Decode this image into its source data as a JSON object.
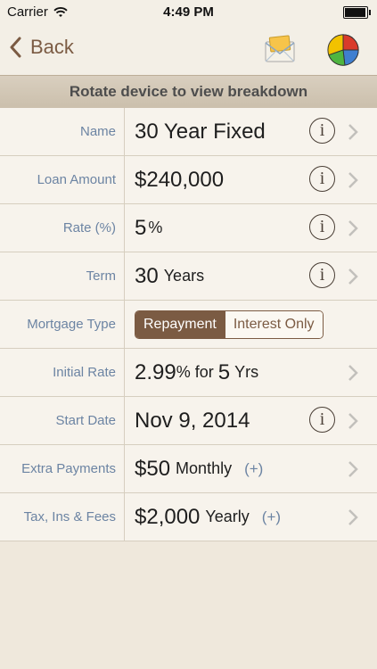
{
  "status": {
    "carrier": "Carrier",
    "time": "4:49 PM",
    "battery_level": 0.95
  },
  "nav": {
    "back_label": "Back",
    "icons": [
      "email-envelope-icon",
      "pie-chart-icon"
    ]
  },
  "banner": "Rotate device to view breakdown",
  "rows": {
    "name": {
      "label": "Name",
      "value": "30 Year Fixed"
    },
    "loan": {
      "label": "Loan Amount",
      "value": "$240,000"
    },
    "rate": {
      "label": "Rate (%)",
      "value": "5",
      "unit": "%"
    },
    "term": {
      "label": "Term",
      "value": "30",
      "unit": "Years"
    },
    "type": {
      "label": "Mortgage Type",
      "options": [
        "Repayment",
        "Interest Only"
      ],
      "selected": "Repayment"
    },
    "initial": {
      "label": "Initial Rate",
      "value": "2.99",
      "unit": "%",
      "connector": "for",
      "years": "5",
      "years_unit": "Yrs"
    },
    "start": {
      "label": "Start Date",
      "value": "Nov 9, 2014"
    },
    "extra": {
      "label": "Extra Payments",
      "value": "$50",
      "unit": "Monthly",
      "add": "(+)"
    },
    "tax": {
      "label": "Tax, Ins & Fees",
      "value": "$2,000",
      "unit": "Yearly",
      "add": "(+)"
    }
  },
  "info_glyph": "i",
  "colors": {
    "accent": "#7b5b43",
    "label_blue": "#6c84a3"
  }
}
